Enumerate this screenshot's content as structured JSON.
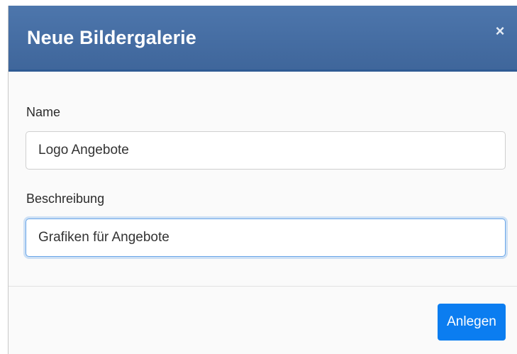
{
  "dialog": {
    "title": "Neue Bildergalerie",
    "close_symbol": "×",
    "close_icon": "close-icon"
  },
  "form": {
    "name_label": "Name",
    "name_value": "Logo Angebote",
    "description_label": "Beschreibung",
    "description_value": "Grafiken für Angebote"
  },
  "footer": {
    "submit_label": "Anlegen"
  },
  "colors": {
    "header_bg": "#4a72a8",
    "accent": "#0b7df0",
    "focus_ring": "#6aa6e8"
  }
}
